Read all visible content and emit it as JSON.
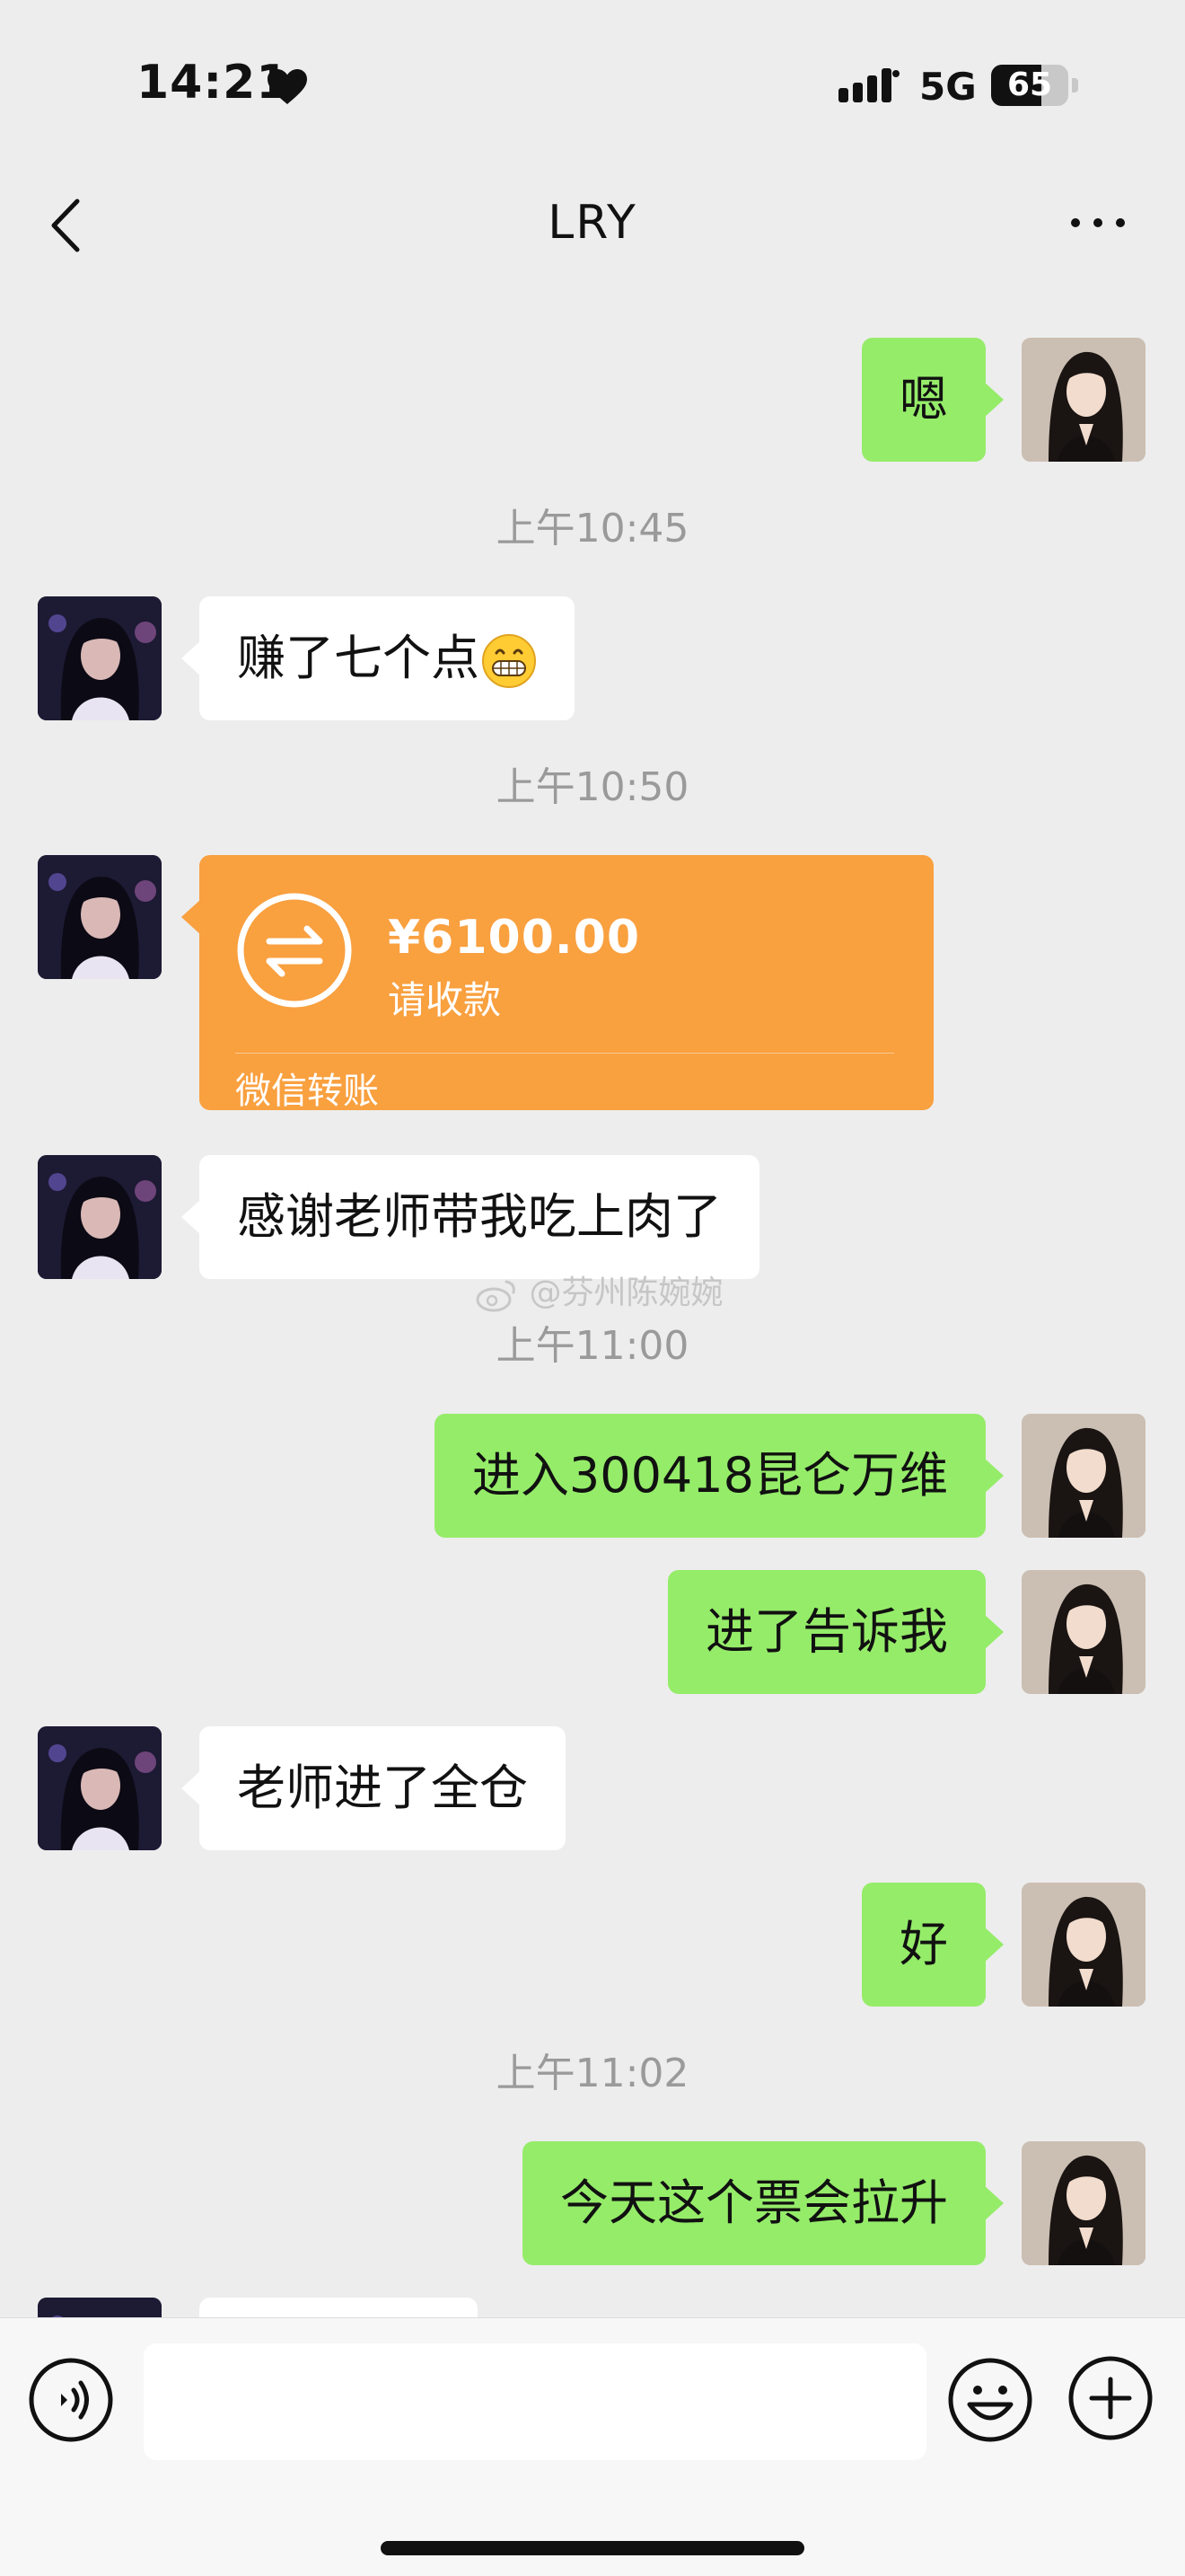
{
  "status_bar": {
    "time": "14:21",
    "network": "5G",
    "battery": "65",
    "battery_level": 0.65
  },
  "nav": {
    "title": "LRY",
    "back_icon": "chevron-left-icon",
    "more_icon": "more-horizontal-icon"
  },
  "chat": {
    "messages": [
      {
        "side": "right",
        "text": "嗯"
      },
      {
        "timestamp": "上午10:45"
      },
      {
        "side": "left",
        "text": "赚了七个点",
        "emoji": "grinning-face"
      },
      {
        "timestamp": "上午10:50"
      },
      {
        "side": "left",
        "type": "transfer",
        "amount": "¥6100.00",
        "status": "请收款",
        "footer": "微信转账"
      },
      {
        "side": "left",
        "text": "感谢老师带我吃上肉了"
      },
      {
        "timestamp": "上午11:00"
      },
      {
        "side": "right",
        "text": "进入300418昆仑万维"
      },
      {
        "side": "right",
        "text": "进了告诉我"
      },
      {
        "side": "left",
        "text": "老师进了全仓"
      },
      {
        "side": "right",
        "text": "好"
      },
      {
        "timestamp": "上午11:02"
      },
      {
        "side": "right",
        "text": "今天这个票会拉升"
      }
    ]
  },
  "watermark": "@芬州陈婉婉",
  "input_bar": {
    "voice_icon": "voice-icon",
    "emoji_icon": "smiley-icon",
    "plus_icon": "plus-circle-icon",
    "text_value": ""
  },
  "colors": {
    "background": "#ededed",
    "self_bubble": "#95ec69",
    "other_bubble": "#ffffff",
    "transfer_card": "#f9a03f"
  }
}
